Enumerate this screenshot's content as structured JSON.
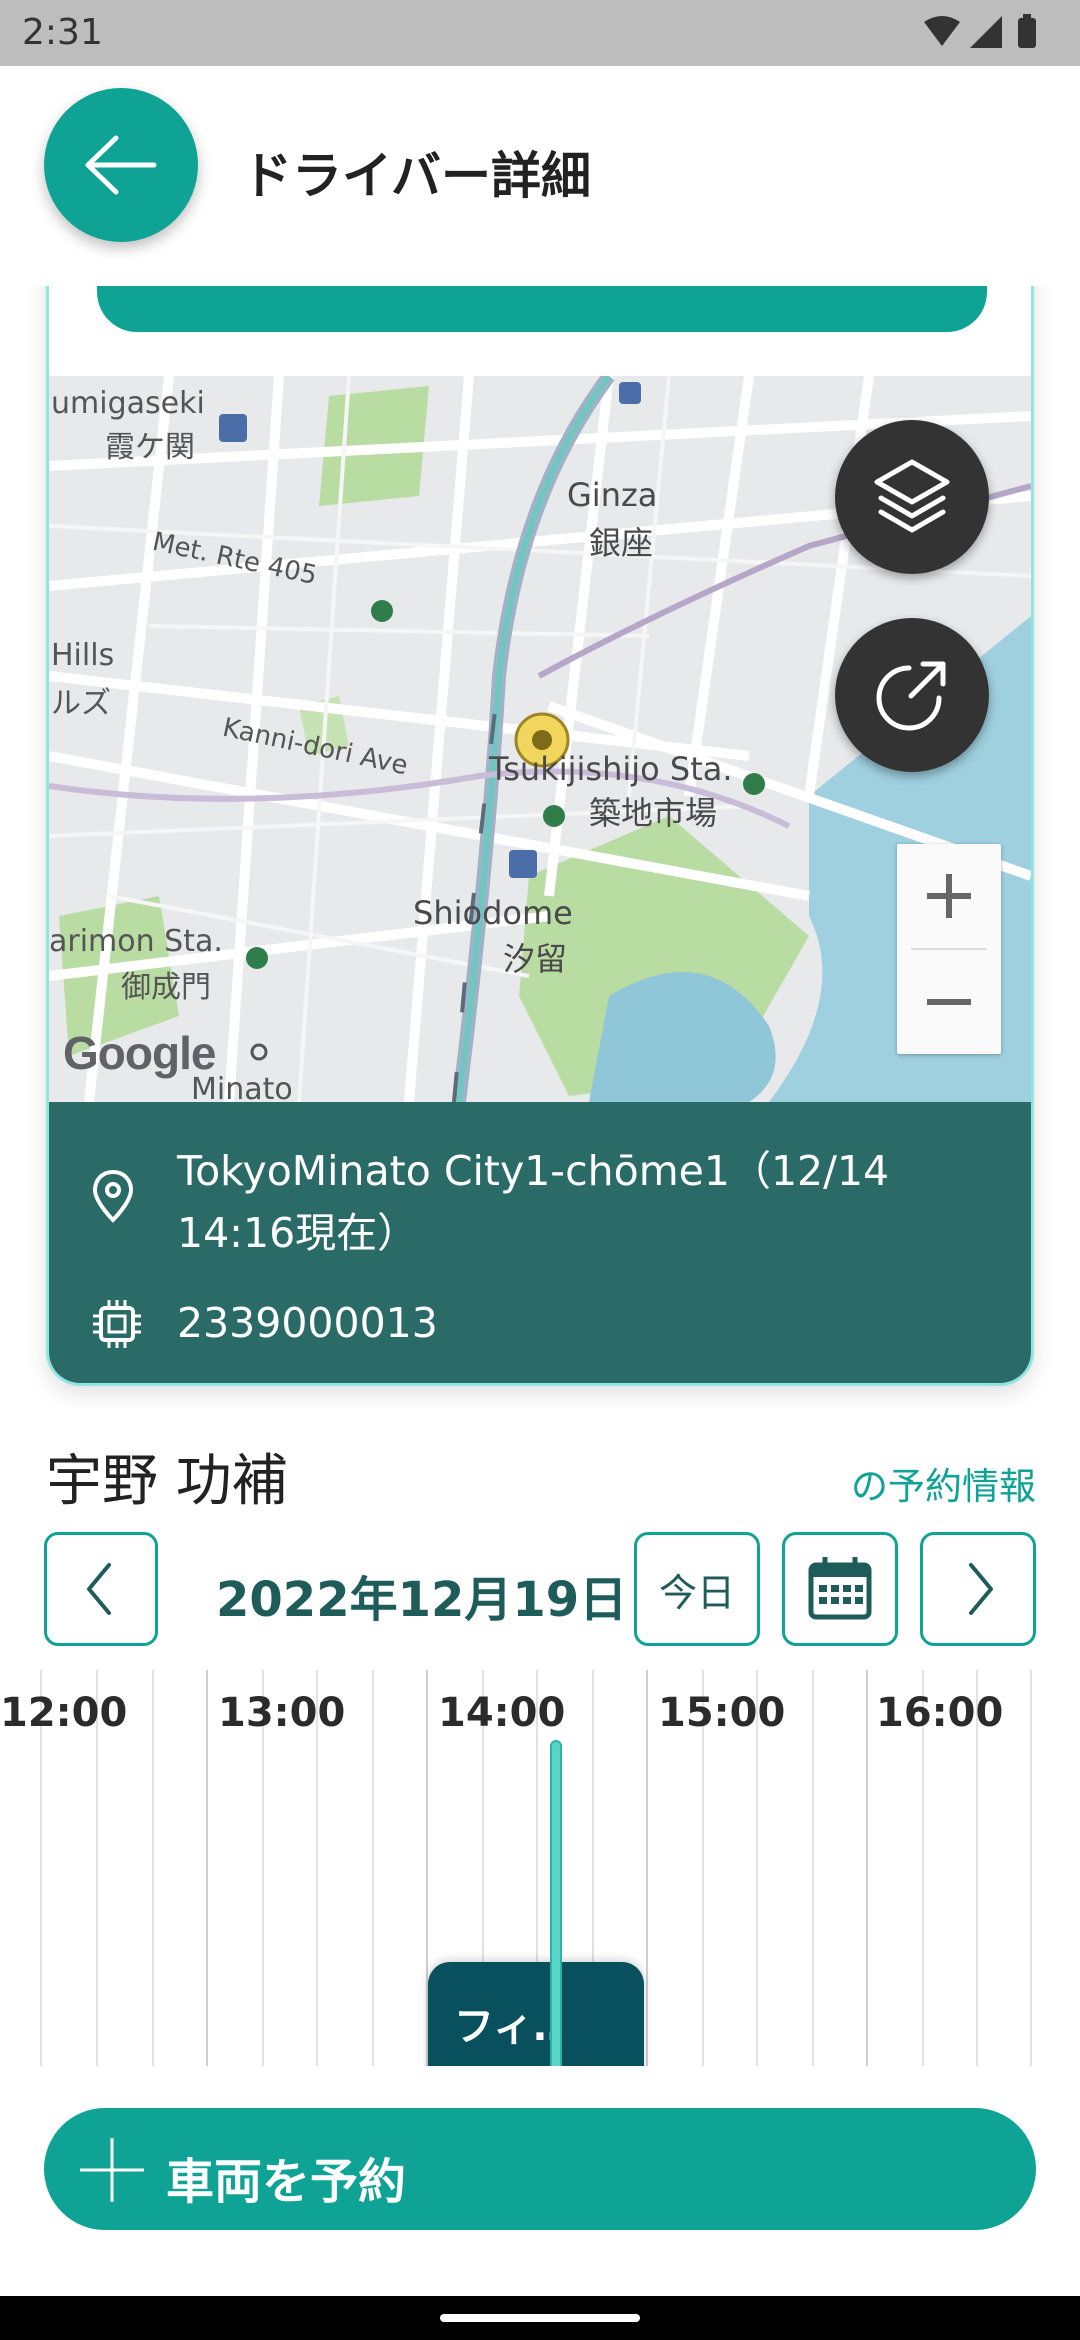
{
  "status_bar": {
    "time": "2:31"
  },
  "header": {
    "title": "ドライバー詳細"
  },
  "map": {
    "labels": {
      "kasumigaseki_en": "umigaseki",
      "kasumigaseki_ja": "霞ケ関",
      "ginza_en": "Ginza",
      "ginza_ja": "銀座",
      "route405": "Met. Rte 405",
      "hills_en": "Hills",
      "hills_ja": "ルズ",
      "kannidori": "Kanni-dori Ave",
      "tsukiji_en": "Tsukijishijo Sta.",
      "tsukiji_ja": "築地市場",
      "shiodome_en": "Shiodome",
      "shiodome_ja": "汐留",
      "onarimon_en": "arimon Sta.",
      "onarimon_ja": "御成門",
      "minato": "Minato",
      "google": "Google"
    },
    "zoom_in": "+",
    "zoom_out": "−"
  },
  "vehicle_info": {
    "location": "TokyoMinato City1-chōme1（12/14",
    "location_line2": "14:16現在）",
    "device_id": "2339000013"
  },
  "reservation": {
    "driver_name": "宇野 功補",
    "section_label": "の予約情報",
    "date": "2022年12月19日",
    "today_label": "今日",
    "hours": [
      "12:00",
      "13:00",
      "14:00",
      "15:00",
      "16:00"
    ],
    "booking_label": "フィ‥"
  },
  "book_button": {
    "label": "車両を予約"
  },
  "colors": {
    "accent": "#0ea395",
    "info_panel": "#2a6b68",
    "booking": "#09505e"
  }
}
